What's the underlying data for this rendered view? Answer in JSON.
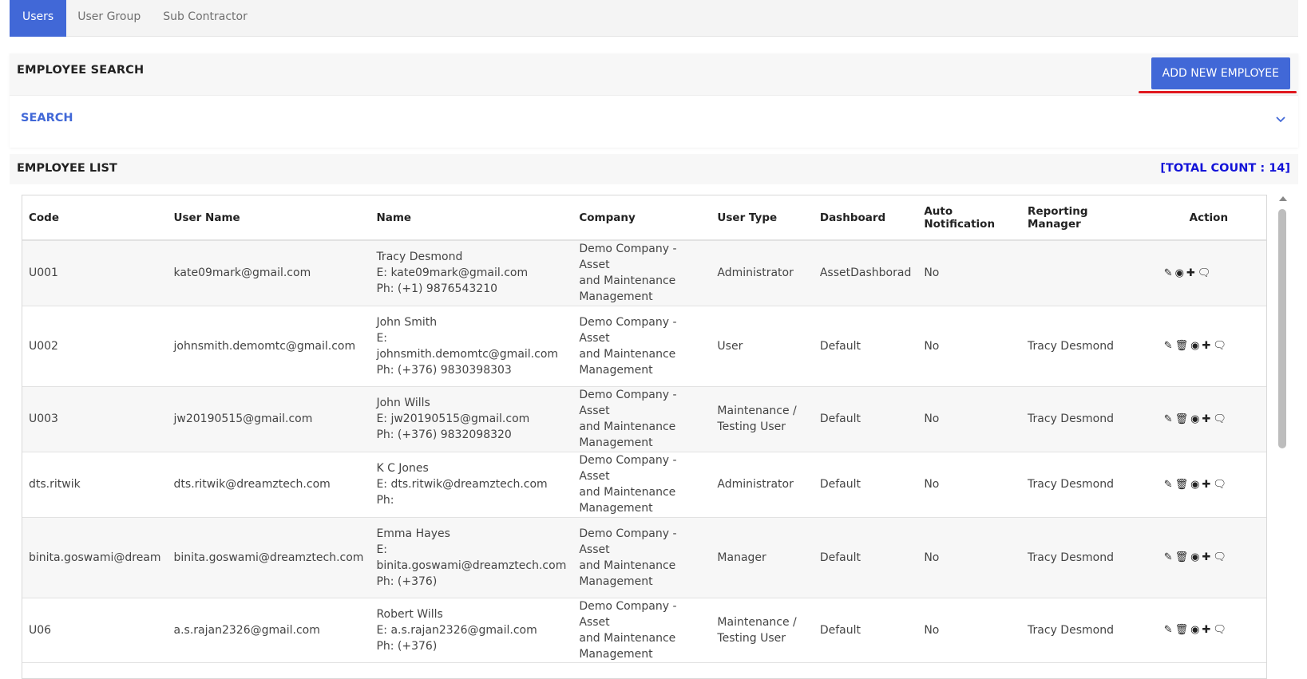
{
  "tabs": [
    {
      "label": "Users",
      "active": true
    },
    {
      "label": "User Group",
      "active": false
    },
    {
      "label": "Sub Contractor",
      "active": false
    }
  ],
  "search_card": {
    "title": "EMPLOYEE SEARCH",
    "add_button_label": "ADD NEW EMPLOYEE",
    "search_label": "SEARCH",
    "toggle_icon": "chevron-down-icon"
  },
  "list_card": {
    "title": "EMPLOYEE LIST",
    "total_count": "[TOTAL COUNT : 14]"
  },
  "table": {
    "columns": [
      "Code",
      "User Name",
      "Name",
      "Company",
      "User Type",
      "Dashboard",
      "Auto Notification",
      "Reporting Manager",
      "Action"
    ],
    "rows": [
      {
        "code": "U001",
        "username": "kate09mark@gmail.com",
        "name": [
          "Tracy Desmond",
          "E: kate09mark@gmail.com",
          "Ph: (+1) 9876543210"
        ],
        "company": [
          "Demo Company - Asset",
          "and Maintenance",
          "Management"
        ],
        "usertype": [
          "Administrator"
        ],
        "dashboard": "AssetDashborad",
        "auto": "No",
        "manager": "",
        "actions": [
          "edit-icon",
          "view-icon",
          "add-icon",
          "comment-icon"
        ]
      },
      {
        "code": "U002",
        "username": "johnsmith.demomtc@gmail.com",
        "name": [
          "John Smith",
          "E:",
          "johnsmith.demomtc@gmail.com",
          "Ph: (+376) 9830398303"
        ],
        "company": [
          "Demo Company - Asset",
          "and Maintenance",
          "Management"
        ],
        "usertype": [
          "User"
        ],
        "dashboard": "Default",
        "auto": "No",
        "manager": "Tracy Desmond",
        "actions": [
          "edit-icon",
          "delete-icon",
          "view-icon",
          "add-icon",
          "comment-icon"
        ]
      },
      {
        "code": "U003",
        "username": "jw20190515@gmail.com",
        "name": [
          "John Wills",
          "E: jw20190515@gmail.com",
          "Ph: (+376) 9832098320"
        ],
        "company": [
          "Demo Company - Asset",
          "and Maintenance",
          "Management"
        ],
        "usertype": [
          "Maintenance /",
          "Testing User"
        ],
        "dashboard": "Default",
        "auto": "No",
        "manager": "Tracy Desmond",
        "actions": [
          "edit-icon",
          "delete-icon",
          "view-icon",
          "add-icon",
          "comment-icon"
        ]
      },
      {
        "code": "dts.ritwik",
        "username": "dts.ritwik@dreamztech.com",
        "name": [
          "K C Jones",
          "E: dts.ritwik@dreamztech.com",
          "Ph:"
        ],
        "company": [
          "Demo Company - Asset",
          "and Maintenance",
          "Management"
        ],
        "usertype": [
          "Administrator"
        ],
        "dashboard": "Default",
        "auto": "No",
        "manager": "Tracy Desmond",
        "actions": [
          "edit-icon",
          "delete-icon",
          "view-icon",
          "add-icon",
          "comment-icon"
        ]
      },
      {
        "code": "binita.goswami@dream",
        "username": "binita.goswami@dreamztech.com",
        "name": [
          "Emma Hayes",
          "E:",
          "binita.goswami@dreamztech.com",
          "Ph: (+376)"
        ],
        "company": [
          "Demo Company - Asset",
          "and Maintenance",
          "Management"
        ],
        "usertype": [
          "Manager"
        ],
        "dashboard": "Default",
        "auto": "No",
        "manager": "Tracy Desmond",
        "actions": [
          "edit-icon",
          "delete-icon",
          "view-icon",
          "add-icon",
          "comment-icon"
        ]
      },
      {
        "code": "U06",
        "username": "a.s.rajan2326@gmail.com",
        "name": [
          "Robert Wills",
          "E: a.s.rajan2326@gmail.com",
          "Ph: (+376)"
        ],
        "company": [
          "Demo Company - Asset",
          "and Maintenance",
          "Management"
        ],
        "usertype": [
          "Maintenance /",
          "Testing User"
        ],
        "dashboard": "Default",
        "auto": "No",
        "manager": "Tracy Desmond",
        "actions": [
          "edit-icon",
          "delete-icon",
          "view-icon",
          "add-icon",
          "comment-icon"
        ]
      }
    ]
  }
}
